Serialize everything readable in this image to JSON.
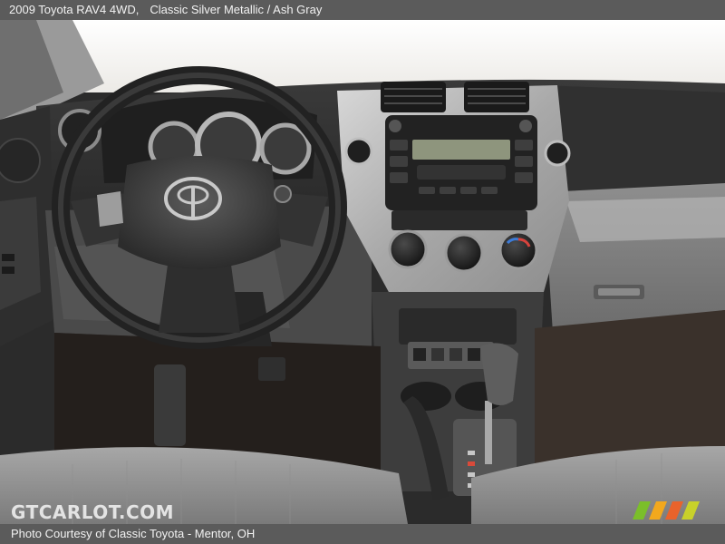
{
  "header": {
    "vehicle": "2009 Toyota RAV4 4WD",
    "colors": "Classic Silver Metallic / Ash Gray"
  },
  "footer": {
    "credit": "Photo Courtesy of Classic Toyota - Mentor, OH"
  },
  "watermark": {
    "text": "GTCARLOT.COM"
  },
  "logo_colors": [
    "#7bbf2a",
    "#f2a81d",
    "#e9632b",
    "#c8d12a"
  ]
}
